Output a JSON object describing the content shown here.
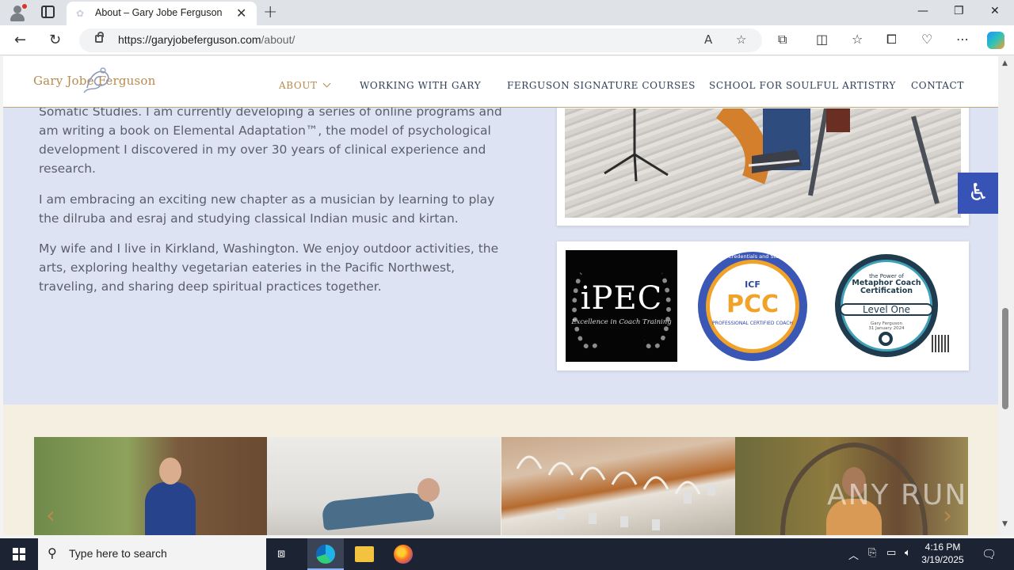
{
  "browser": {
    "tab_title": "About – Gary Jobe Ferguson",
    "url_host": "https://garyjobeferguson.com",
    "url_path": "/about/"
  },
  "site": {
    "logo_text": "Gary Jobe Ferguson",
    "nav": [
      {
        "label": "ABOUT"
      },
      {
        "label": "WORKING WITH GARY"
      },
      {
        "label": "FERGUSON SIGNATURE COURSES"
      },
      {
        "label": "SCHOOL FOR SOULFUL ARTISTRY"
      },
      {
        "label": "CONTACT"
      }
    ]
  },
  "content": {
    "para1": "Somatic Studies. I am currently developing a series of online programs and am writing a book on Elemental Adaptation™, the model of psychological development I discovered in my over 30 years of clinical experience and research.",
    "para2": "I am embracing an exciting new chapter as a musician by learning to play the dilruba and esraj and studying classical Indian music and kirtan.",
    "para3": "My wife and I live in Kirkland, Washington. We enjoy outdoor activities, the arts, exploring healthy vegetarian eateries in the Pacific Northwest, traveling, and sharing deep spiritual practices together."
  },
  "badges": {
    "ipec_title": "iPEC",
    "ipec_sub": "Excellence in Coach Training",
    "icf_ring": "ICF Credentials and Standards",
    "icf_logo": "ICF",
    "pcc": "PCC",
    "pcc_sub": "PROFESSIONAL CERTIFIED COACH",
    "meta_top": "the Power of",
    "meta_title": "Metaphor Coach Certification",
    "meta_level": "Level One",
    "meta_name": "Gary Ferguson",
    "meta_date": "31 January 2024"
  },
  "watermark": "ANY RUN",
  "taskbar": {
    "search_placeholder": "Type here to search",
    "time": "4:16 PM",
    "date": "3/19/2025"
  }
}
